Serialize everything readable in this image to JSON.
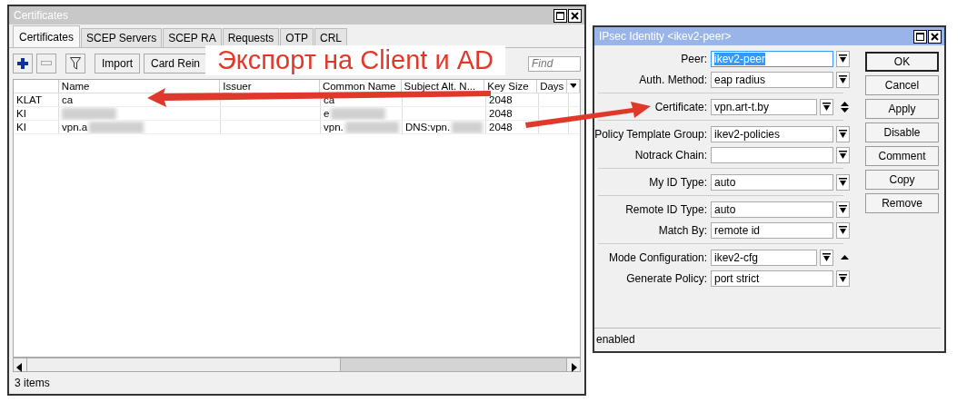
{
  "certificates_window": {
    "title": "Certificates",
    "tabs": [
      {
        "label": "Certificates",
        "selected": true
      },
      {
        "label": "SCEP Servers",
        "selected": false
      },
      {
        "label": "SCEP RA",
        "selected": false
      },
      {
        "label": "Requests",
        "selected": false
      },
      {
        "label": "OTP",
        "selected": false
      },
      {
        "label": "CRL",
        "selected": false
      }
    ],
    "toolbar": [
      {
        "kind": "add"
      },
      {
        "kind": "remove",
        "disabled": true
      },
      {
        "kind": "filter"
      },
      {
        "kind": "text",
        "label": "Import"
      },
      {
        "kind": "text",
        "label": "Card Rein"
      }
    ],
    "search": {
      "placeholder": "Find"
    },
    "columns": [
      "",
      "Name",
      "Issuer",
      "Common Name",
      "Subject Alt. N...",
      "Key Size",
      "Days"
    ],
    "rows": [
      {
        "cells": [
          {
            "text": "KLAT"
          },
          {
            "text": "ca"
          },
          {
            "text": ""
          },
          {
            "text": "ca"
          },
          {
            "text": ""
          },
          {
            "text": "2048"
          },
          {
            "text": ""
          }
        ]
      },
      {
        "cells": [
          {
            "text": "KI"
          },
          {
            "text": "",
            "blurred": true
          },
          {
            "text": ""
          },
          {
            "text": "e",
            "blurred": true
          },
          {
            "text": ""
          },
          {
            "text": "2048"
          },
          {
            "text": ""
          }
        ]
      },
      {
        "cells": [
          {
            "text": "KI"
          },
          {
            "text": "vpn.a",
            "blurred": true
          },
          {
            "text": ""
          },
          {
            "text": "vpn.",
            "blurred": true
          },
          {
            "text": "DNS:vpn.",
            "blurred": true
          },
          {
            "text": "2048"
          },
          {
            "text": ""
          }
        ]
      }
    ],
    "status": "3 items"
  },
  "ipsec_window": {
    "title": "IPsec Identity <ikev2-peer>",
    "groups": [
      [
        {
          "kind": "plain",
          "label": "Peer:",
          "value": "ikev2-peer",
          "selected": true
        },
        {
          "kind": "plain",
          "label": "Auth. Method:",
          "value": "eap radius",
          "selected": false
        }
      ],
      [
        {
          "kind": "expandable",
          "label": "Certificate:",
          "value": "vpn.art-t.by",
          "selected": false
        }
      ],
      [
        {
          "kind": "plain",
          "label": "Policy Template Group:",
          "value": "ikev2-policies",
          "selected": false
        },
        {
          "kind": "plain",
          "label": "Notrack Chain:",
          "selected": false
        }
      ],
      [
        {
          "kind": "plain",
          "label": "My ID Type:",
          "value": "auto",
          "selected": false
        }
      ],
      [
        {
          "kind": "plain",
          "label": "Remote ID Type:",
          "value": "auto",
          "selected": false
        },
        {
          "kind": "plain",
          "label": "Match By:",
          "value": "remote id",
          "selected": false
        }
      ],
      [
        {
          "kind": "collapsible",
          "label": "Mode Configuration:",
          "value": "ikev2-cfg",
          "selected": false
        },
        {
          "kind": "plain",
          "label": "Generate Policy:",
          "value": "port strict",
          "selected": false
        }
      ]
    ],
    "buttons": [
      {
        "label": "OK",
        "default": true
      },
      {
        "label": "Cancel",
        "default": false
      },
      {
        "label": "Apply",
        "default": false
      },
      {
        "label": "Disable",
        "default": false
      },
      {
        "label": "Comment",
        "default": false
      },
      {
        "label": "Copy",
        "default": false
      },
      {
        "label": "Remove",
        "default": false
      }
    ],
    "status": "enabled"
  },
  "annotation": {
    "text": "Экспорт на Client и AD"
  }
}
